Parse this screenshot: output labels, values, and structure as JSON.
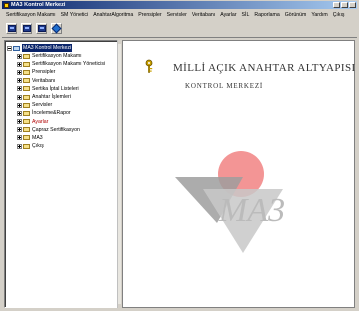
{
  "window": {
    "title": "MA3 Kontrol Merkezi"
  },
  "menubar": {
    "items": [
      {
        "label": "Sertifikasyon Makamı"
      },
      {
        "label": "SM Yönetici"
      },
      {
        "label": "AnahtarAlgoritma"
      },
      {
        "label": "Prensipler"
      },
      {
        "label": "Servisler"
      },
      {
        "label": "Veritabanı"
      },
      {
        "label": "Ayarlar"
      },
      {
        "label": "SİL"
      },
      {
        "label": "Raporlama"
      },
      {
        "label": "Görünüm"
      },
      {
        "label": "Yardım"
      },
      {
        "label": "Çıkış"
      }
    ]
  },
  "toolbar": {
    "buttons": [
      {
        "icon": "document-icon"
      },
      {
        "icon": "document-icon"
      },
      {
        "icon": "document-icon"
      },
      {
        "icon": "diamond-icon"
      }
    ]
  },
  "tree": {
    "root_label": "MA3 Kontrol Merkezi",
    "items": [
      {
        "label": "Sertifikasyon Makamı",
        "icon": "folder",
        "expander": "plus"
      },
      {
        "label": "Sertifikasyon Makamı Yöneticisi",
        "icon": "folder",
        "expander": "plus"
      },
      {
        "label": "Prensipler",
        "icon": "folder",
        "expander": "plus"
      },
      {
        "label": "Veritabanı",
        "icon": "folder",
        "expander": "plus"
      },
      {
        "label": "Sertika İptal Listeleri",
        "icon": "folder",
        "expander": "plus"
      },
      {
        "label": "Anahtar İşlemleri",
        "icon": "folder",
        "expander": "plus"
      },
      {
        "label": "Servisler",
        "icon": "folder",
        "expander": "plus"
      },
      {
        "label": "İnceleme&Rapor",
        "icon": "folder",
        "expander": "plus"
      },
      {
        "label": "Ayarlar",
        "icon": "folder",
        "expander": "plus",
        "color": "red"
      },
      {
        "label": "Çapraz Sertifikasyon",
        "icon": "folder",
        "expander": "plus"
      },
      {
        "label": "MA3",
        "icon": "folder",
        "expander": "plus"
      },
      {
        "label": "Çıkış",
        "icon": "folder",
        "expander": "plus"
      }
    ]
  },
  "main": {
    "title": "MİLLİ AÇIK ANAHTAR ALTYAPISI",
    "subtitle": "KONTROL MERKEZİ",
    "logo_text": "MA3",
    "colors": {
      "logo_circle": "#f28a8a",
      "logo_chevron": "#b8b8b8",
      "title_text": "#333333"
    }
  }
}
